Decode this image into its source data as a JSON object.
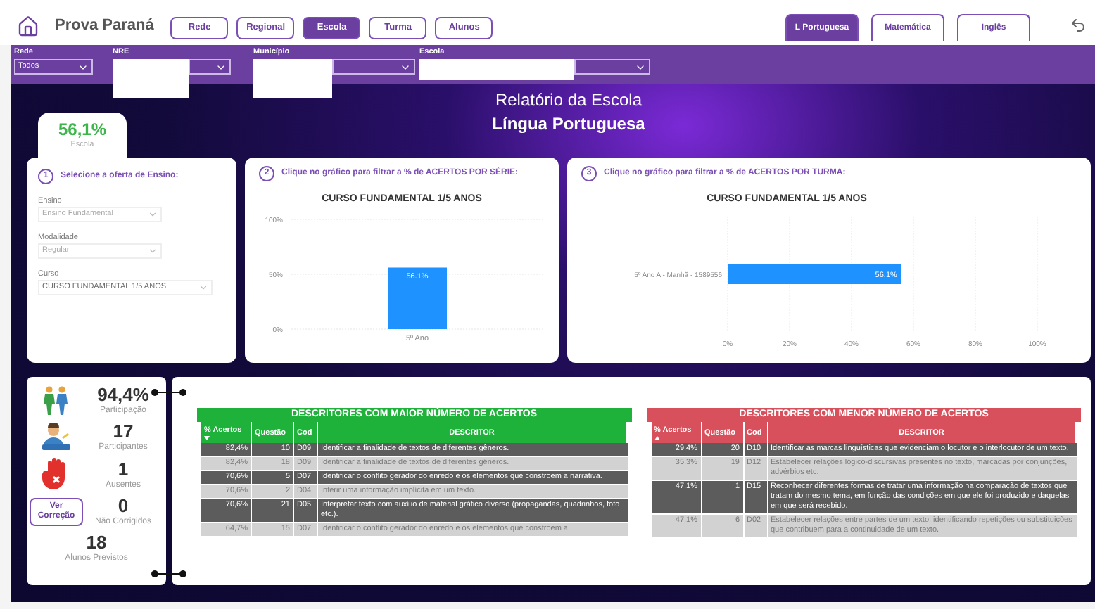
{
  "header": {
    "title": "Prova Paraná",
    "nav": [
      {
        "label": "Rede",
        "selected": false
      },
      {
        "label": "Regional",
        "selected": false
      },
      {
        "label": "Escola",
        "selected": true
      },
      {
        "label": "Turma",
        "selected": false
      },
      {
        "label": "Alunos",
        "selected": false
      }
    ],
    "subjects": [
      {
        "label": "L Portuguesa",
        "selected": true
      },
      {
        "label": "Matemática",
        "selected": false
      },
      {
        "label": "Inglês",
        "selected": false
      }
    ]
  },
  "filters": [
    {
      "label": "Rede",
      "value": "Todos",
      "redacted": false
    },
    {
      "label": "NRE",
      "redacted": true
    },
    {
      "label": "Município",
      "redacted": true
    },
    {
      "label": "Escola",
      "redacted": true
    }
  ],
  "report": {
    "title": "Relatório da Escola",
    "subtitle": "Língua Portuguesa"
  },
  "score_tab": {
    "value": "56,1%",
    "label": "Escola"
  },
  "panel_offer": {
    "step": "1",
    "title": "Selecione a oferta de Ensino:",
    "fields": [
      {
        "label": "Ensino",
        "value": "Ensino Fundamental",
        "disabled": true
      },
      {
        "label": "Modalidade",
        "value": "Regular",
        "disabled": true
      },
      {
        "label": "Curso",
        "value": "CURSO FUNDAMENTAL 1/5 ANOS",
        "disabled": false
      }
    ]
  },
  "panel_series": {
    "step": "2",
    "title": "Clique no gráfico para filtrar a % de ACERTOS POR SÉRIE:",
    "chart_data": {
      "type": "bar",
      "title": "CURSO FUNDAMENTAL 1/5 ANOS",
      "categories": [
        "5º Ano"
      ],
      "series": [
        {
          "color": "#1e93ff",
          "values": [
            56.1
          ]
        }
      ],
      "grid": true,
      "ylim": [
        0,
        100
      ],
      "yticks": [
        {
          "value": 0,
          "label": "0%"
        },
        {
          "value": 50,
          "label": "50%"
        },
        {
          "value": 100,
          "label": "100%"
        }
      ],
      "value_labels": [
        "56.1%"
      ]
    }
  },
  "panel_class": {
    "step": "3",
    "title": "Clique no gráfico para filtrar a % de ACERTOS POR TURMA:",
    "chart_data": {
      "type": "bar",
      "orientation": "horizontal",
      "title": "CURSO FUNDAMENTAL 1/5 ANOS",
      "categories": [
        "5º Ano A - Manhã - 1589556"
      ],
      "series": [
        {
          "color": "#1e93ff",
          "values": [
            56.1
          ]
        }
      ],
      "grid": true,
      "xlim": [
        0,
        100
      ],
      "xticks": [
        {
          "value": 0,
          "label": "0%"
        },
        {
          "value": 20,
          "label": "20%"
        },
        {
          "value": 40,
          "label": "40%"
        },
        {
          "value": 60,
          "label": "60%"
        },
        {
          "value": 80,
          "label": "80%"
        },
        {
          "value": 100,
          "label": "100%"
        }
      ],
      "value_labels": [
        "56.1%"
      ]
    }
  },
  "stats": [
    {
      "kind": "walkers",
      "value": "94,4%",
      "label": "Participação"
    },
    {
      "kind": "student",
      "value": "17",
      "label": "Participantes"
    },
    {
      "kind": "stop",
      "value": "1",
      "label": "Ausentes"
    },
    {
      "kind": "button",
      "button": "Ver Correção",
      "value": "0",
      "label": "Não Corrigidos"
    },
    {
      "kind": "plain",
      "value": "18",
      "label": "Alunos Previstos"
    }
  ],
  "tables": [
    {
      "kind": "best",
      "title": "DESCRITORES COM MAIOR NÚMERO DE ACERTOS",
      "sort_ascending": false,
      "columns": [
        "% Acertos",
        "Questão",
        "Cod",
        "DESCRITOR"
      ],
      "rows": [
        {
          "pct": "82,4%",
          "question": "10",
          "code": "D09",
          "descriptor": "Identificar a finalidade de textos de diferentes gêneros."
        },
        {
          "pct": "82,4%",
          "question": "18",
          "code": "D09",
          "descriptor": "Identificar a finalidade de textos de diferentes gêneros."
        },
        {
          "pct": "70,6%",
          "question": "5",
          "code": "D07",
          "descriptor": "Identificar o conflito gerador do enredo e os elementos que constroem a narrativa."
        },
        {
          "pct": "70,6%",
          "question": "2",
          "code": "D04",
          "descriptor": "Inferir uma informação implícita em um texto."
        },
        {
          "pct": "70,6%",
          "question": "21",
          "code": "D05",
          "descriptor": "Interpretar texto com auxílio de material gráfico diverso (propagandas, quadrinhos, foto etc.)."
        },
        {
          "pct": "64,7%",
          "question": "15",
          "code": "D07",
          "descriptor": "Identificar o conflito gerador do enredo e os elementos que constroem a"
        }
      ]
    },
    {
      "kind": "worst",
      "title": "DESCRITORES COM MENOR NÚMERO DE ACERTOS",
      "sort_ascending": true,
      "columns": [
        "% Acertos",
        "Questão",
        "Cod",
        "DESCRITOR"
      ],
      "rows": [
        {
          "pct": "29,4%",
          "question": "20",
          "code": "D10",
          "descriptor": "Identificar as marcas linguísticas que evidenciam o locutor e o interlocutor de um texto."
        },
        {
          "pct": "35,3%",
          "question": "19",
          "code": "D12",
          "descriptor": "Estabelecer relações lógico-discursivas presentes no texto, marcadas por conjunções, advérbios etc."
        },
        {
          "pct": "47,1%",
          "question": "1",
          "code": "D15",
          "descriptor": "Reconhecer diferentes formas de tratar uma informação na comparação de textos que tratam do mesmo tema, em função das condições em que ele foi produzido e daquelas em que será recebido."
        },
        {
          "pct": "47,1%",
          "question": "6",
          "code": "D02",
          "descriptor": "Estabelecer relações entre partes de um texto, identificando repetições ou substituições que contribuem para a continuidade de um texto."
        }
      ]
    }
  ]
}
